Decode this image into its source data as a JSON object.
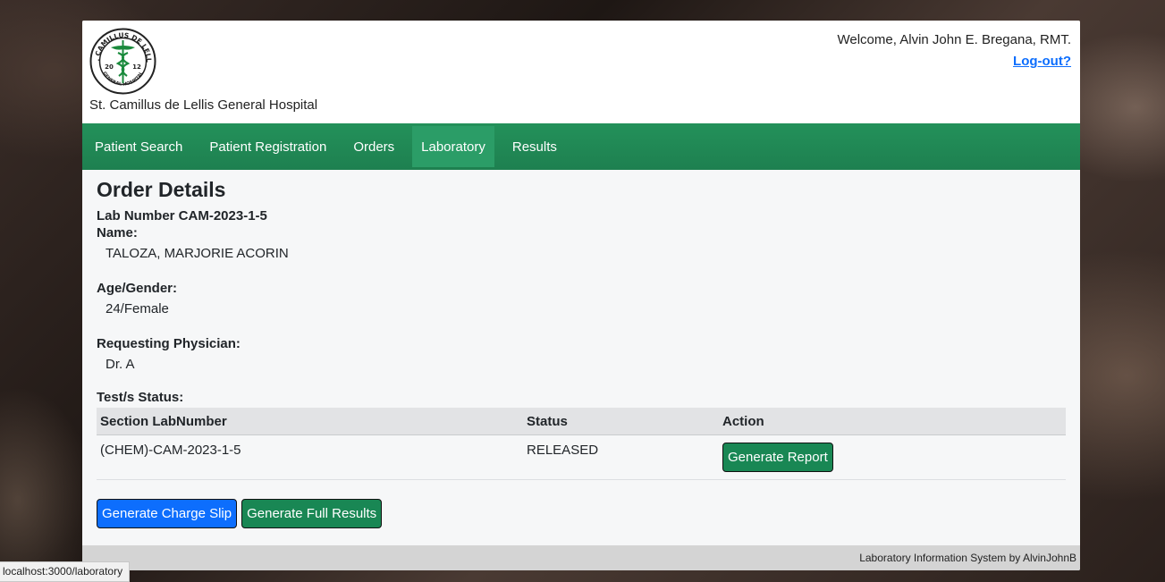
{
  "header": {
    "hospital_name": "St. Camillus de Lellis General Hospital",
    "welcome": "Welcome, Alvin John E. Bregana, RMT.",
    "logout": "Log-out?",
    "logo_top_text": "ST. CAMILLUS DE LELLIS",
    "logo_bottom_text": "GENERAL HOSPITAL",
    "logo_left": "20",
    "logo_right": "12"
  },
  "nav": {
    "items": [
      {
        "label": "Patient Search"
      },
      {
        "label": "Patient Registration"
      },
      {
        "label": "Orders"
      },
      {
        "label": "Laboratory",
        "active": true
      },
      {
        "label": "Results"
      }
    ]
  },
  "order": {
    "title": "Order Details",
    "lab_number": "Lab Number CAM-2023-1-5",
    "name_label": "Name:",
    "name_value": "TALOZA, MARJORIE ACORIN",
    "age_label": "Age/Gender:",
    "age_value": "24/Female",
    "physician_label": "Requesting Physician:",
    "physician_value": "Dr. A",
    "tests_label": "Test/s Status:"
  },
  "table": {
    "headers": [
      "Section LabNumber",
      "Status",
      "Action"
    ],
    "rows": [
      {
        "section": "(CHEM)-CAM-2023-1-5",
        "status": "RELEASED",
        "action": "Generate Report"
      }
    ]
  },
  "buttons": {
    "charge_slip": "Generate Charge Slip",
    "full_results": "Generate Full Results"
  },
  "footer": "Laboratory Information System by AlvinJohnB",
  "statusbar": "localhost:3000/laboratory",
  "colors": {
    "nav_green": "#1e8050",
    "button_green": "#198754",
    "button_blue": "#0d6efd",
    "link_blue": "#0d6efd"
  }
}
